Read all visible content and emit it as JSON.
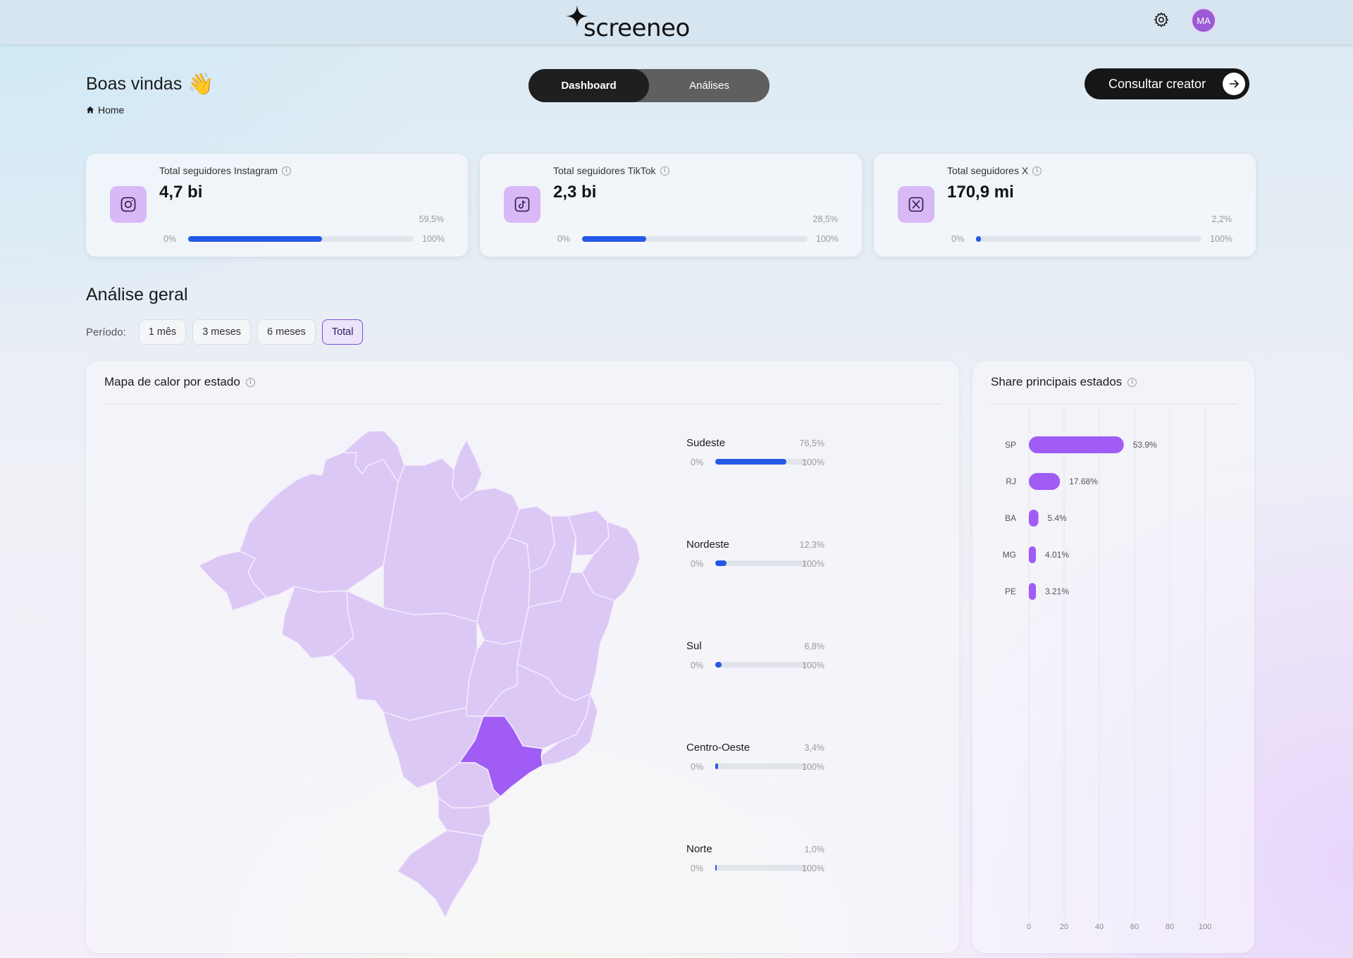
{
  "header": {
    "logo_text": "screeneo",
    "avatar_initials": "MA"
  },
  "greeting": {
    "title": "Boas vindas",
    "emoji": "👋",
    "breadcrumb": "Home"
  },
  "view_toggle": {
    "active": "Dashboard",
    "inactive": "Análises"
  },
  "cta": {
    "label": "Consultar creator"
  },
  "stats": [
    {
      "label": "Total seguidores Instagram",
      "value": "4,7 bi",
      "percent_label": "59,5%",
      "percent": 59.5,
      "min": "0%",
      "max": "100%",
      "icon": "instagram-icon"
    },
    {
      "label": "Total seguidores TikTok",
      "value": "2,3 bi",
      "percent_label": "28,5%",
      "percent": 28.5,
      "min": "0%",
      "max": "100%",
      "icon": "tiktok-icon"
    },
    {
      "label": "Total seguidores X",
      "value": "170,9 mi",
      "percent_label": "2,2%",
      "percent": 2.2,
      "min": "0%",
      "max": "100%",
      "icon": "x-icon"
    }
  ],
  "analysis": {
    "title": "Análise geral",
    "period_label": "Período:",
    "periods": [
      "1 mês",
      "3 meses",
      "6 meses",
      "Total"
    ],
    "selected_period": "Total"
  },
  "heatmap": {
    "title": "Mapa de calor por estado",
    "highlighted_state": "SP",
    "regions": [
      {
        "name": "Sudeste",
        "percent_label": "76,5%",
        "percent": 76.5,
        "min": "0%",
        "max": "100%"
      },
      {
        "name": "Nordeste",
        "percent_label": "12,3%",
        "percent": 12.3,
        "min": "0%",
        "max": "100%"
      },
      {
        "name": "Sul",
        "percent_label": "6,8%",
        "percent": 6.8,
        "min": "0%",
        "max": "100%"
      },
      {
        "name": "Centro-Oeste",
        "percent_label": "3,4%",
        "percent": 3.4,
        "min": "0%",
        "max": "100%"
      },
      {
        "name": "Norte",
        "percent_label": "1,0%",
        "percent": 1.0,
        "min": "0%",
        "max": "100%"
      }
    ]
  },
  "share": {
    "title": "Share principais estados"
  },
  "chart_data": {
    "type": "bar",
    "orientation": "horizontal",
    "categories": [
      "SP",
      "RJ",
      "BA",
      "MG",
      "PE"
    ],
    "values": [
      53.9,
      17.68,
      5.4,
      4.01,
      3.21
    ],
    "value_labels": [
      "53.9%",
      "17.68%",
      "5.4%",
      "4.01%",
      "3.21%"
    ],
    "xlim": [
      0,
      100
    ],
    "xticks": [
      "0",
      "20",
      "40",
      "60",
      "80",
      "100"
    ],
    "grid": true,
    "colors": {
      "bar": "#a05cf5"
    }
  },
  "colors": {
    "accent_blue": "#2458e6",
    "accent_purple": "#a05cf5",
    "map_base": "#dcc8f5",
    "map_highlight": "#a05cf5"
  }
}
